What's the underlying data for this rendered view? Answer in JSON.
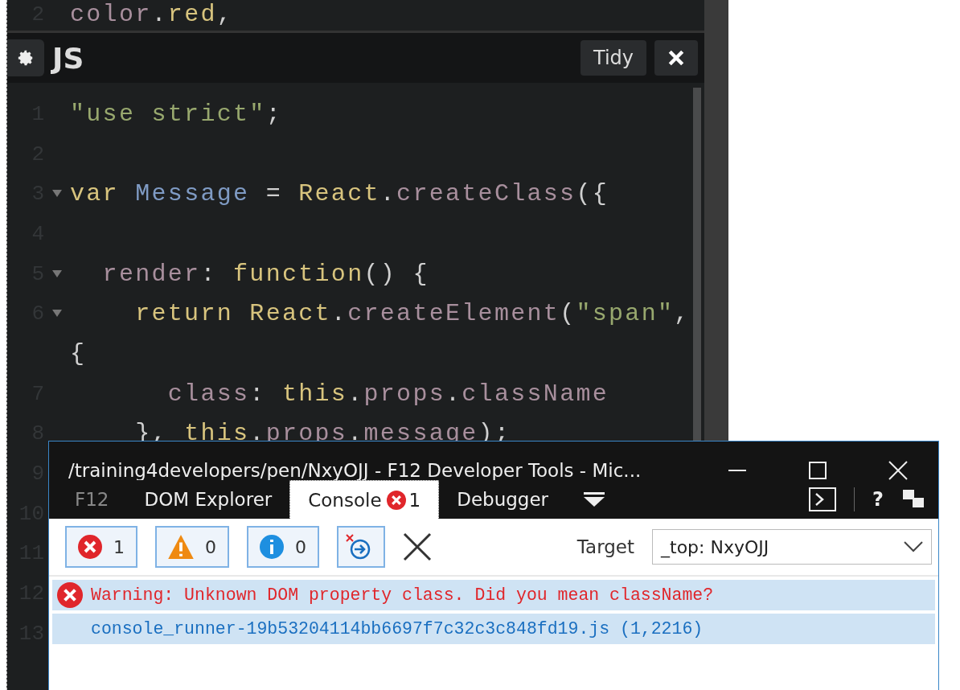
{
  "above_editor": {
    "line_number": "2",
    "tokens": [
      {
        "kind": "prop",
        "text": "color"
      },
      {
        "kind": "plain",
        "text": "."
      },
      {
        "kind": "kw",
        "text": "red"
      },
      {
        "kind": "plain",
        "text": ","
      }
    ]
  },
  "editor": {
    "title": "JS",
    "tidy_label": "Tidy",
    "lines": [
      {
        "number": "1",
        "foldable": false,
        "tokens": [
          {
            "kind": "str",
            "text": "\"use strict\""
          },
          {
            "kind": "plain",
            "text": ";"
          }
        ]
      },
      {
        "number": "2",
        "foldable": false
      },
      {
        "number": "3",
        "foldable": true,
        "tokens": [
          {
            "kind": "kw",
            "text": "var "
          },
          {
            "kind": "def",
            "text": "Message"
          },
          {
            "kind": "plain",
            "text": " = "
          },
          {
            "kind": "kw",
            "text": "React"
          },
          {
            "kind": "plain",
            "text": "."
          },
          {
            "kind": "prop",
            "text": "createClass"
          },
          {
            "kind": "plain",
            "text": "({"
          }
        ]
      },
      {
        "number": "4",
        "foldable": false
      },
      {
        "number": "5",
        "foldable": true,
        "tokens": [
          {
            "kind": "prop",
            "text": "  render"
          },
          {
            "kind": "plain",
            "text": ": "
          },
          {
            "kind": "kw",
            "text": "function"
          },
          {
            "kind": "plain",
            "text": "() {"
          }
        ]
      },
      {
        "number": "6",
        "foldable": true,
        "tokens": [
          {
            "kind": "kw",
            "text": "    return "
          },
          {
            "kind": "kw",
            "text": "React"
          },
          {
            "kind": "plain",
            "text": "."
          },
          {
            "kind": "prop",
            "text": "createElement"
          },
          {
            "kind": "plain",
            "text": "("
          },
          {
            "kind": "str",
            "text": "\"span\""
          },
          {
            "kind": "plain",
            "text": ","
          }
        ]
      },
      {
        "foldable": false,
        "tokens": [
          {
            "kind": "plain",
            "text": "{"
          }
        ]
      },
      {
        "number": "7",
        "foldable": false,
        "tokens": [
          {
            "kind": "prop",
            "text": "      class"
          },
          {
            "kind": "plain",
            "text": ": "
          },
          {
            "kind": "kw",
            "text": "this"
          },
          {
            "kind": "plain",
            "text": "."
          },
          {
            "kind": "prop",
            "text": "props"
          },
          {
            "kind": "plain",
            "text": "."
          },
          {
            "kind": "prop",
            "text": "className"
          }
        ]
      },
      {
        "number": "8",
        "foldable": false,
        "tokens": [
          {
            "kind": "plain",
            "text": "    }, "
          },
          {
            "kind": "kw",
            "text": "this"
          },
          {
            "kind": "plain",
            "text": "."
          },
          {
            "kind": "prop",
            "text": "props"
          },
          {
            "kind": "plain",
            "text": "."
          },
          {
            "kind": "prop",
            "text": "message"
          },
          {
            "kind": "plain",
            "text": ");"
          }
        ]
      },
      {
        "number": "9",
        "foldable": false
      },
      {
        "number": "10",
        "foldable": false
      },
      {
        "number": "11",
        "foldable": false
      },
      {
        "number": "12",
        "foldable": false
      },
      {
        "number": "13",
        "foldable": false
      }
    ]
  },
  "devtools": {
    "title": "/training4developers/pen/NxyOJJ - F12 Developer Tools - Mic...",
    "tabs": [
      {
        "label": "F12",
        "selected": false,
        "disabled": true
      },
      {
        "label": "DOM Explorer",
        "selected": false,
        "disabled": false
      },
      {
        "label": "Console",
        "selected": true,
        "disabled": false,
        "badge": "1"
      },
      {
        "label": "Debugger",
        "selected": false,
        "disabled": false
      }
    ],
    "help_label": "?",
    "filters": [
      {
        "kind": "error",
        "count": "1",
        "selected": true
      },
      {
        "kind": "warning",
        "count": "0",
        "selected": true
      },
      {
        "kind": "info",
        "count": "0",
        "selected": true
      }
    ],
    "clear_on_navigate": {
      "selected": true
    },
    "target_label": "Target",
    "target_value": "_top: NxyOJJ",
    "messages": [
      {
        "kind": "error",
        "text": "Warning: Unknown DOM property class. Did you mean className?",
        "source": "console_runner-19b53204114bb6697f7c32c3c848fd19.js (1,2216)"
      }
    ]
  }
}
